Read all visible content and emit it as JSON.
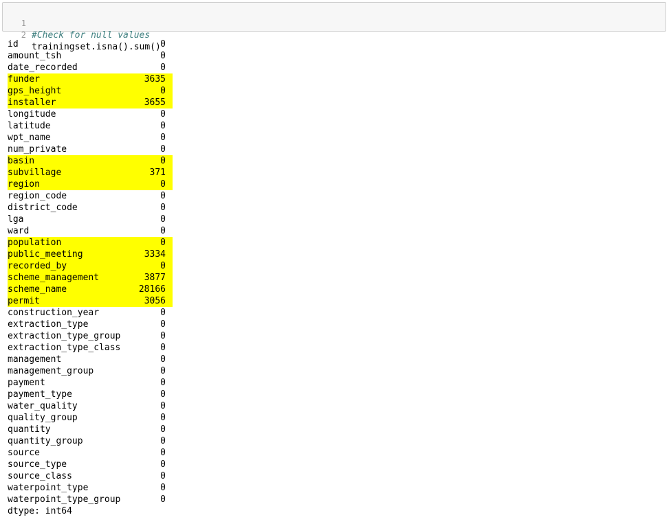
{
  "input": {
    "lines": [
      {
        "number": "1",
        "code": "#Check for null values"
      },
      {
        "number": "2",
        "code": "trainingset.isna().sum()"
      }
    ]
  },
  "output": {
    "rows": [
      {
        "name": "id",
        "value": "0",
        "highlighted": false
      },
      {
        "name": "amount_tsh",
        "value": "0",
        "highlighted": false
      },
      {
        "name": "date_recorded",
        "value": "0",
        "highlighted": false
      },
      {
        "name": "funder",
        "value": "3635",
        "highlighted": true
      },
      {
        "name": "gps_height",
        "value": "0",
        "highlighted": true
      },
      {
        "name": "installer",
        "value": "3655",
        "highlighted": true
      },
      {
        "name": "longitude",
        "value": "0",
        "highlighted": false
      },
      {
        "name": "latitude",
        "value": "0",
        "highlighted": false
      },
      {
        "name": "wpt_name",
        "value": "0",
        "highlighted": false
      },
      {
        "name": "num_private",
        "value": "0",
        "highlighted": false
      },
      {
        "name": "basin",
        "value": "0",
        "highlighted": true
      },
      {
        "name": "subvillage",
        "value": "371",
        "highlighted": true
      },
      {
        "name": "region",
        "value": "0",
        "highlighted": true
      },
      {
        "name": "region_code",
        "value": "0",
        "highlighted": false
      },
      {
        "name": "district_code",
        "value": "0",
        "highlighted": false
      },
      {
        "name": "lga",
        "value": "0",
        "highlighted": false
      },
      {
        "name": "ward",
        "value": "0",
        "highlighted": false
      },
      {
        "name": "population",
        "value": "0",
        "highlighted": true
      },
      {
        "name": "public_meeting",
        "value": "3334",
        "highlighted": true
      },
      {
        "name": "recorded_by",
        "value": "0",
        "highlighted": true
      },
      {
        "name": "scheme_management",
        "value": "3877",
        "highlighted": true
      },
      {
        "name": "scheme_name",
        "value": "28166",
        "highlighted": true
      },
      {
        "name": "permit",
        "value": "3056",
        "highlighted": true
      },
      {
        "name": "construction_year",
        "value": "0",
        "highlighted": false
      },
      {
        "name": "extraction_type",
        "value": "0",
        "highlighted": false
      },
      {
        "name": "extraction_type_group",
        "value": "0",
        "highlighted": false
      },
      {
        "name": "extraction_type_class",
        "value": "0",
        "highlighted": false
      },
      {
        "name": "management",
        "value": "0",
        "highlighted": false
      },
      {
        "name": "management_group",
        "value": "0",
        "highlighted": false
      },
      {
        "name": "payment",
        "value": "0",
        "highlighted": false
      },
      {
        "name": "payment_type",
        "value": "0",
        "highlighted": false
      },
      {
        "name": "water_quality",
        "value": "0",
        "highlighted": false
      },
      {
        "name": "quality_group",
        "value": "0",
        "highlighted": false
      },
      {
        "name": "quantity",
        "value": "0",
        "highlighted": false
      },
      {
        "name": "quantity_group",
        "value": "0",
        "highlighted": false
      },
      {
        "name": "source",
        "value": "0",
        "highlighted": false
      },
      {
        "name": "source_type",
        "value": "0",
        "highlighted": false
      },
      {
        "name": "source_class",
        "value": "0",
        "highlighted": false
      },
      {
        "name": "waterpoint_type",
        "value": "0",
        "highlighted": false
      },
      {
        "name": "waterpoint_type_group",
        "value": "0",
        "highlighted": false
      }
    ],
    "dtype": "dtype: int64"
  },
  "colors": {
    "highlight": "#ffff00",
    "comment": "#408080",
    "cell_background": "#f7f7f7",
    "cell_border": "#cfcfcf"
  }
}
